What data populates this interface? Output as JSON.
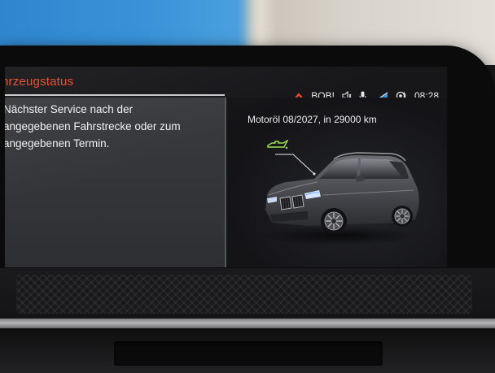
{
  "header": {
    "title": "hrzeugstatus"
  },
  "status_bar": {
    "profile_label": "BOB!",
    "time": "08:28"
  },
  "left_panel": {
    "lines": [
      "Nächster Service nach der",
      "angegebenen Fahrstrecke oder zum",
      "angegebenen Termin."
    ]
  },
  "right_panel": {
    "service_item": "Motoröl  08/2027, in 29000 km"
  },
  "colors": {
    "accent": "#e84b2c",
    "oil_icon": "#9be04a"
  },
  "icons": [
    "chevron-up-icon",
    "speaker-icon",
    "microphone-icon",
    "signal-icon",
    "connected-drive-icon",
    "oil-can-icon"
  ]
}
